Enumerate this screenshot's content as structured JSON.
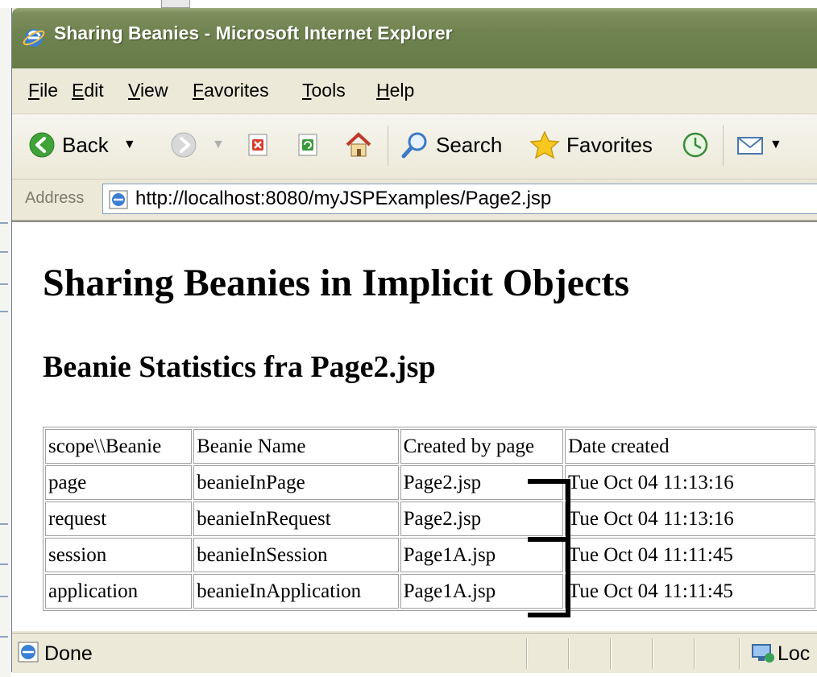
{
  "window": {
    "title": "Sharing Beanies - Microsoft Internet Explorer"
  },
  "menu": [
    "File",
    "Edit",
    "View",
    "Favorites",
    "Tools",
    "Help"
  ],
  "toolbar": {
    "back_label": "Back",
    "search_label": "Search",
    "favorites_label": "Favorites",
    "icons": [
      "back-icon",
      "forward-icon",
      "stop-icon",
      "refresh-icon",
      "home-icon",
      "search-icon",
      "favorites-star-icon",
      "history-icon",
      "mail-icon"
    ]
  },
  "address": {
    "label": "Address",
    "url": "http://localhost:8080/myJSPExamples/Page2.jsp"
  },
  "page": {
    "heading": "Sharing Beanies in Implicit Objects",
    "subheading": "Beanie Statistics fra Page2.jsp",
    "table": {
      "headers": [
        "scope\\\\Beanie",
        "Beanie Name",
        "Created by page",
        "Date created"
      ],
      "rows": [
        [
          "page",
          "beanieInPage",
          "Page2.jsp",
          "Tue Oct 04 11:13:16"
        ],
        [
          "request",
          "beanieInRequest",
          "Page2.jsp",
          "Tue Oct 04 11:13:16"
        ],
        [
          "session",
          "beanieInSession",
          "Page1A.jsp",
          "Tue Oct 04 11:11:45"
        ],
        [
          "application",
          "beanieInApplication",
          "Page1A.jsp",
          "Tue Oct 04 11:11:45"
        ]
      ]
    }
  },
  "status": {
    "text": "Done",
    "zone_text": "Loc"
  },
  "colors": {
    "titlebar": "#6f8350",
    "chrome": "#ece9d8",
    "address_border": "#7f9db9"
  }
}
